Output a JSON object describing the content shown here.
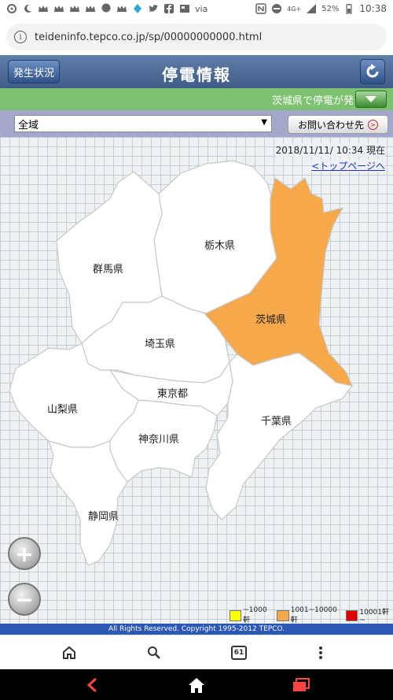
{
  "status_bar": {
    "carrier_text": "via",
    "network": "4G+",
    "battery": "52%",
    "time": "10:38",
    "icons": [
      "settings-icon",
      "moon-icon",
      "crown-icon",
      "crown-icon",
      "crown-icon",
      "crown-icon",
      "message-icon",
      "crown-icon",
      "notification-icon",
      "twitter-icon",
      "facebook-icon",
      "news-icon",
      "nfc-icon",
      "minus-circle-icon",
      "signal-icon",
      "battery-icon"
    ]
  },
  "browser": {
    "url": "teideninfo.tepco.co.jp/sp/00000000000.html",
    "tab_count": "61"
  },
  "header": {
    "status_button": "発生状況",
    "title": "停電情報"
  },
  "ticker": {
    "text": "茨城県で停電が発"
  },
  "controls": {
    "area_selected": "全域",
    "contact_button": "お問い合わせ先"
  },
  "map": {
    "datetime": "2018/11/11/ 10:34 現在",
    "top_link": "<トップページへ",
    "prefectures": [
      {
        "name": "栃木県",
        "label": "栃木県",
        "status": "none"
      },
      {
        "name": "群馬県",
        "label": "群馬県",
        "status": "none"
      },
      {
        "name": "茨城県",
        "label": "茨城県",
        "status": "1001-10000"
      },
      {
        "name": "埼玉県",
        "label": "埼玉県",
        "status": "none"
      },
      {
        "name": "東京都",
        "label": "東京都",
        "status": "none"
      },
      {
        "name": "山梨県",
        "label": "山梨県",
        "status": "none"
      },
      {
        "name": "千葉県",
        "label": "千葉県",
        "status": "none"
      },
      {
        "name": "神奈川県",
        "label": "神奈川県",
        "status": "none"
      },
      {
        "name": "静岡県",
        "label": "静岡県",
        "status": "none"
      }
    ],
    "zoom_in": "+",
    "zoom_out": "−"
  },
  "legend": [
    {
      "label": "~1000軒",
      "color": "#ffff00"
    },
    {
      "label": "1001~10000軒",
      "color": "#f6a84a"
    },
    {
      "label": "10001軒~",
      "color": "#e00000"
    }
  ],
  "footer": {
    "copyright": "All Rights Reserved. Copyright 1995-2012 TEPCO."
  },
  "colors": {
    "header": "#4a6a96",
    "ticker": "#7cc270",
    "controls": "#a3a7cb",
    "affected": "#f6a84a",
    "footer": "#2b57b5"
  }
}
